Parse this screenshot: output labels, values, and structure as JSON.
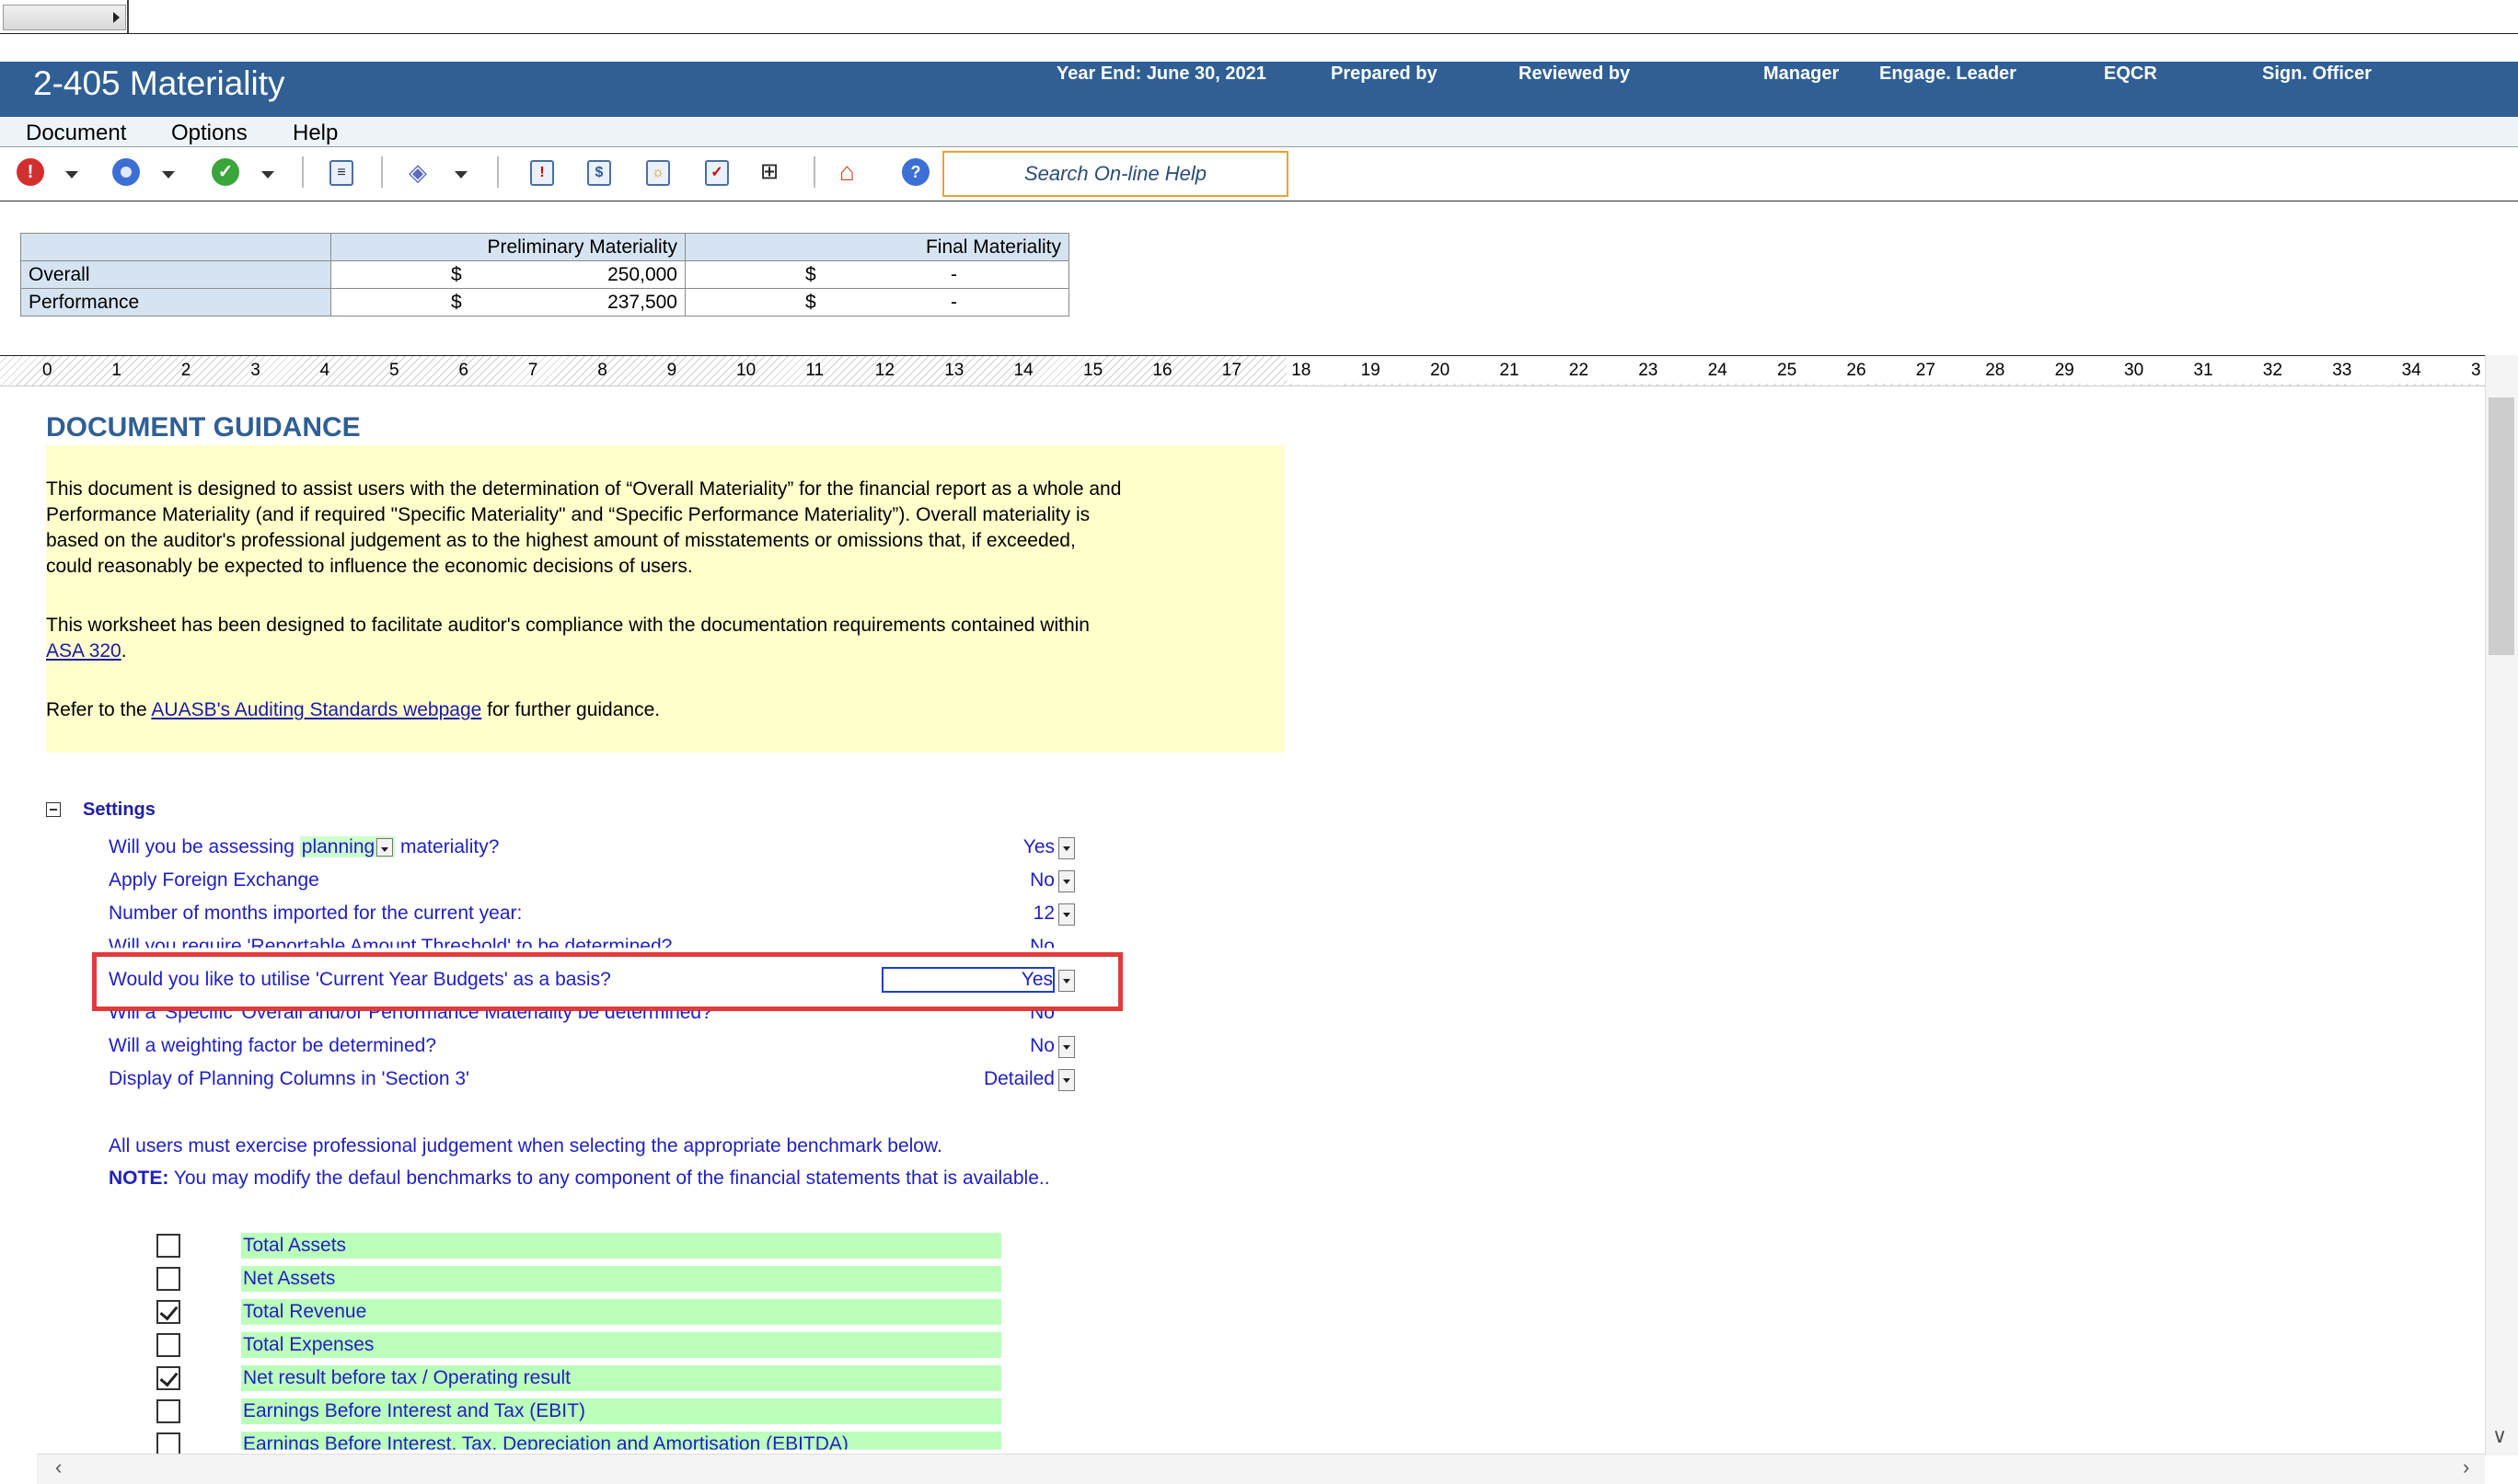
{
  "header": {
    "title": "2-405 Materiality",
    "year_end": "Year End: June 30, 2021",
    "prepared_by": "Prepared by",
    "reviewed_by": "Reviewed by",
    "manager": "Manager",
    "engage_leader": "Engage. Leader",
    "eqcr": "EQCR",
    "sign_officer": "Sign. Officer"
  },
  "menu": [
    "Document",
    "Options",
    "Help"
  ],
  "toolbar": {
    "search_placeholder": "Search On-line Help",
    "icons": [
      "error-icon",
      "circle-icon",
      "checkmark-icon",
      "form-icon",
      "layers-icon",
      "exclamation-icon",
      "dollar-icon",
      "sun-icon",
      "checklist-icon",
      "insert-icon",
      "home-icon",
      "help-icon"
    ],
    "colors": {
      "error": "#d32f2f",
      "circle": "#3b6fd4",
      "check": "#3aa53a",
      "accent": "#2f5f94"
    }
  },
  "materiality_table": {
    "headers": [
      "Preliminary Materiality",
      "Final Materiality"
    ],
    "rows": [
      {
        "label": "Overall",
        "prelim_cur": "$",
        "prelim_val": "250,000",
        "final_cur": "$",
        "final_val": "-"
      },
      {
        "label": "Performance",
        "prelim_cur": "$",
        "prelim_val": "237,500",
        "final_cur": "$",
        "final_val": "-"
      }
    ]
  },
  "ruler": [
    "0",
    "1",
    "2",
    "3",
    "4",
    "5",
    "6",
    "7",
    "8",
    "9",
    "10",
    "11",
    "12",
    "13",
    "14",
    "15",
    "16",
    "17",
    "18",
    "19",
    "20",
    "21",
    "22",
    "23",
    "24",
    "25",
    "26",
    "27",
    "28",
    "29",
    "30",
    "31",
    "32",
    "33",
    "34",
    "3"
  ],
  "guidance": {
    "title": "DOCUMENT GUIDANCE",
    "p1": [
      "This document is designed to assist users with the determination of “Overall Materiality” for the financial report as a whole and",
      "Performance Materiality (and if required \"Specific Materiality\" and “Specific Performance Materiality”).  Overall materiality is",
      "based on the auditor's professional judgement as to the highest amount of misstatements or omissions that, if exceeded,",
      "could reasonably be expected to influence the economic decisions of users."
    ],
    "p2": "This worksheet has been designed to facilitate auditor's compliance with the documentation requirements contained within",
    "p2_link": "ASA 320",
    "p3_pre": "Refer to the ",
    "p3_link": "AUASB's Auditing Standards webpage",
    "p3_post": " for further guidance."
  },
  "settings": {
    "title": "Settings",
    "q0_pre": "Will you be assessing ",
    "q0_dd": "planning",
    "q0_post": " materiality?",
    "a0": "Yes",
    "q1": "Apply Foreign Exchange",
    "a1": "No",
    "q2": "Number of months imported for the current year:",
    "a2": "12",
    "q3": "Will you require 'Reportable Amount Threshold' to be determined?",
    "a3": "No",
    "q4": "Would you like to utilise 'Current Year Budgets' as a basis?",
    "a4": "Yes",
    "q5": "Will a 'Specific' Overall and/or Performance Materiality be determined?",
    "a5": "No",
    "q6": "Will a weighting factor be determined?",
    "a6": "No",
    "q7": "Display of Planning Columns in 'Section 3'",
    "a7": "Detailed",
    "note1": "All users must exercise professional judgement when selecting the appropriate benchmark below.",
    "note2_label": "NOTE:",
    "note2": " You may modify the defaul benchmarks to any component of the financial statements that is available.."
  },
  "benchmarks": [
    {
      "label": "Total Assets",
      "checked": false
    },
    {
      "label": "Net Assets",
      "checked": false
    },
    {
      "label": "Total Revenue",
      "checked": true
    },
    {
      "label": "Total Expenses",
      "checked": false
    },
    {
      "label": "Net result before tax / Operating result",
      "checked": true
    },
    {
      "label": "Earnings Before Interest and Tax (EBIT)",
      "checked": false
    },
    {
      "label": "Earnings Before Interest, Tax, Depreciation and Amortisation (EBITDA)",
      "checked": false
    }
  ]
}
